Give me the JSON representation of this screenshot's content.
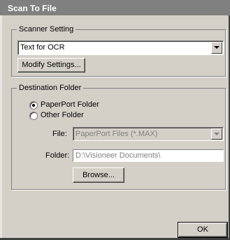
{
  "window": {
    "title": "Scan To File"
  },
  "scanner_setting": {
    "legend": "Scanner Setting",
    "selected_value": "Text for OCR",
    "modify_label": "Modify Settings..."
  },
  "destination": {
    "legend": "Destination Folder",
    "options": [
      {
        "label": "PaperPort Folder",
        "selected": true
      },
      {
        "label": "Other Folder",
        "selected": false
      }
    ],
    "file_label": "File:",
    "file_value": "PaperPort Files (*.MAX)",
    "folder_label": "Folder:",
    "folder_value": "D:\\Visioneer Documents\\",
    "browse_label": "Browse..."
  },
  "footer": {
    "ok_label": "OK"
  }
}
